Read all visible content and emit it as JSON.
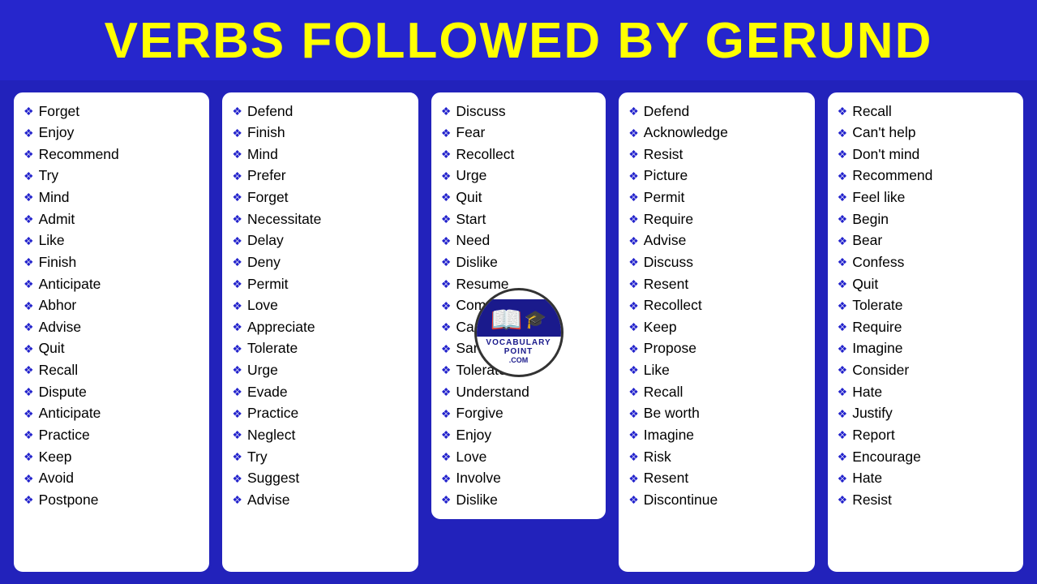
{
  "header": {
    "title": "VERBS FOLLOWED BY GERUND"
  },
  "columns": [
    {
      "id": "col1",
      "words": [
        "Forget",
        "Enjoy",
        "Recommend",
        "Try",
        "Mind",
        "Admit",
        "Like",
        "Finish",
        "Anticipate",
        "Abhor",
        "Advise",
        "Quit",
        "Recall",
        "Dispute",
        "Anticipate",
        "Practice",
        "Keep",
        "Avoid",
        "Postpone"
      ]
    },
    {
      "id": "col2",
      "words": [
        "Defend",
        "Finish",
        "Mind",
        "Prefer",
        "Forget",
        "Necessitate",
        "Delay",
        "Deny",
        "Permit",
        "Love",
        "Appreciate",
        "Tolerate",
        "Urge",
        "Evade",
        "Practice",
        "Neglect",
        "Try",
        "Suggest",
        "Advise"
      ]
    },
    {
      "id": "col3",
      "words": [
        "Discuss",
        "Fear",
        "Recollect",
        "Urge",
        "Quit",
        "Start",
        "Need",
        "Dislike",
        "Resume",
        "Complete",
        "Can't help",
        "Sanction",
        "Tolerate",
        "Understand",
        "Forgive",
        "Enjoy",
        "Love",
        "Involve",
        "Dislike"
      ]
    },
    {
      "id": "col4",
      "words": [
        "Defend",
        "Acknowledge",
        "Resist",
        "Picture",
        "Permit",
        "Require",
        "Advise",
        "Discuss",
        "Resent",
        "Recollect",
        "Keep",
        "Propose",
        "Like",
        "Recall",
        "Be worth",
        "Imagine",
        "Risk",
        "Resent",
        "Discontinue"
      ]
    },
    {
      "id": "col5",
      "words": [
        "Recall",
        "Can't help",
        "Don't mind",
        "Recommend",
        "Feel like",
        "Begin",
        "Bear",
        "Confess",
        "Quit",
        "Tolerate",
        "Require",
        "Imagine",
        "Consider",
        "Hate",
        "Justify",
        "Report",
        "Encourage",
        "Hate",
        "Resist"
      ]
    }
  ],
  "diamond": "❖"
}
